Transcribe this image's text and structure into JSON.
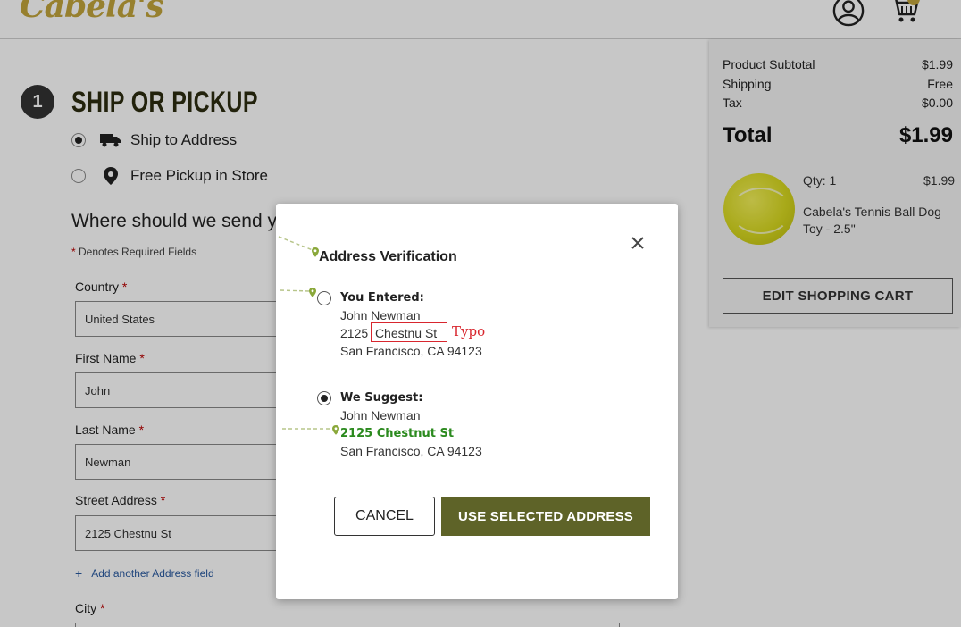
{
  "header": {
    "logo_text": "Cabela's",
    "cart_count": "1"
  },
  "checkout": {
    "step_number": "1",
    "step_title": "SHIP OR PICKUP",
    "options": [
      {
        "label": "Ship to Address",
        "selected": true,
        "icon": "truck-icon"
      },
      {
        "label": "Free Pickup in Store",
        "selected": false,
        "icon": "map-pin-icon"
      }
    ],
    "heading": "Where should we send y",
    "required_note": "Denotes Required Fields",
    "required_star": "*",
    "fields": {
      "country_label": "Country",
      "country_value": "United States",
      "first_name_label": "First Name",
      "first_name_value": "John",
      "last_name_label": "Last Name",
      "last_name_value": "Newman",
      "street_label": "Street Address",
      "street_value": "2125 Chestnu St",
      "city_label": "City"
    },
    "add_field_plus": "+",
    "add_field_text": "Add another Address field"
  },
  "summary": {
    "subtotal_label": "Product Subtotal",
    "subtotal_value": "$1.99",
    "shipping_label": "Shipping",
    "shipping_value": "Free",
    "tax_label": "Tax",
    "tax_value": "$0.00",
    "total_label": "Total",
    "total_value": "$1.99",
    "item_qty": "Qty: 1",
    "item_price": "$1.99",
    "item_name": "Cabela's Tennis Ball Dog Toy - 2.5\"",
    "edit_cart_label": "EDIT SHOPPING CART"
  },
  "modal": {
    "title": "Address Verification",
    "entered_heading": "You Entered:",
    "entered_name": "John Newman",
    "entered_street_number": "2125",
    "entered_street_name": "Chestnu St",
    "entered_city": "San Francisco, CA 94123",
    "typo_label": "Typo",
    "suggest_heading": "We Suggest:",
    "suggest_name": "John Newman",
    "suggest_street": "2125 Chestnut St",
    "suggest_city": "San Francisco, CA 94123",
    "selected_option": "suggested",
    "cancel_label": "CANCEL",
    "use_label": "USE SELECTED ADDRESS"
  },
  "colors": {
    "brand_gold": "#c2a43c",
    "primary_button": "#5e6328",
    "typo_red": "#d8262e",
    "suggest_green": "#2b8a1e",
    "annotation_green": "#8aa83a"
  }
}
